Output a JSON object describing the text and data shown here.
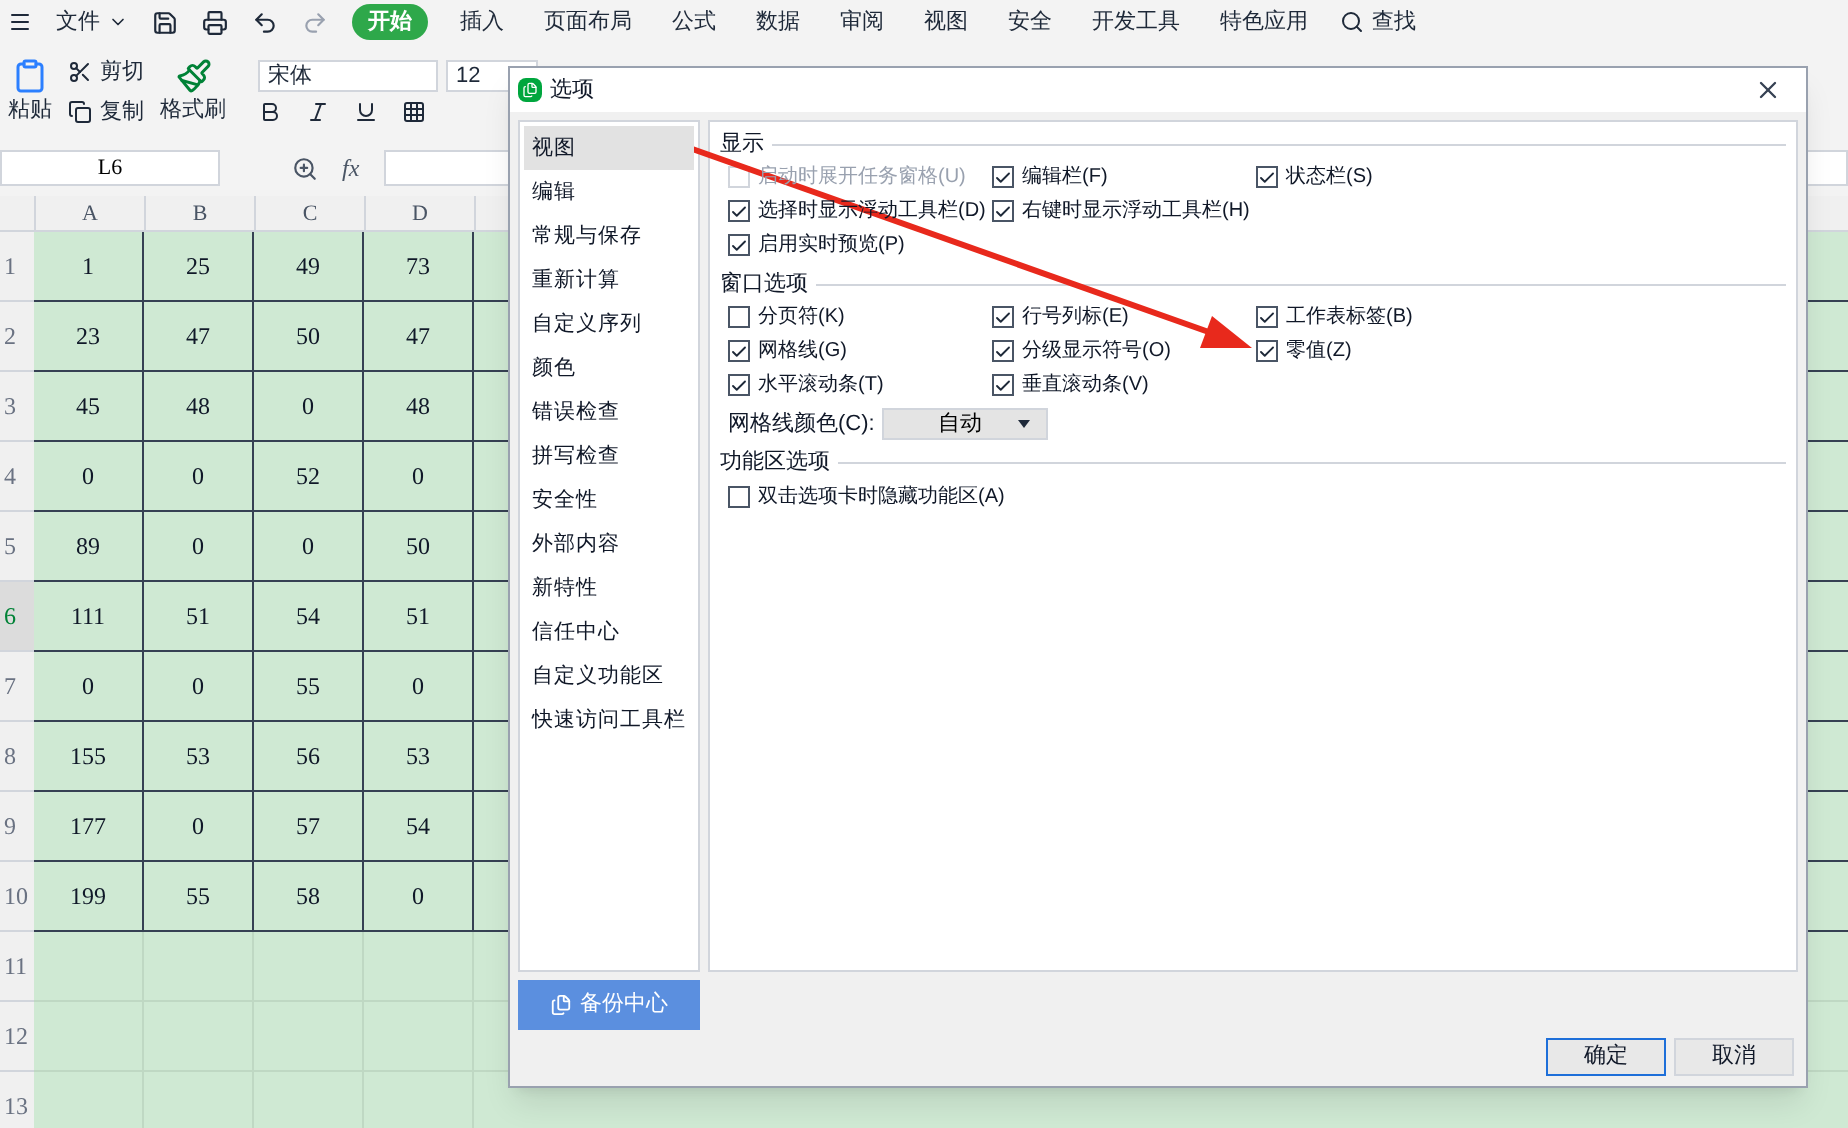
{
  "menu_bar": {
    "file": "文件",
    "tabs": [
      {
        "label": "开始",
        "selected": true
      },
      {
        "label": "插入",
        "selected": false
      },
      {
        "label": "页面布局",
        "selected": false
      },
      {
        "label": "公式",
        "selected": false
      },
      {
        "label": "数据",
        "selected": false
      },
      {
        "label": "审阅",
        "selected": false
      },
      {
        "label": "视图",
        "selected": false
      },
      {
        "label": "安全",
        "selected": false
      },
      {
        "label": "开发工具",
        "selected": false
      },
      {
        "label": "特色应用",
        "selected": false
      }
    ],
    "search": "查找"
  },
  "toolbar": {
    "paste": "粘贴",
    "cut": "剪切",
    "copy": "复制",
    "format_painter": "格式刷",
    "font": "宋体",
    "font_size": "12"
  },
  "formula_bar": {
    "cell": "L6",
    "fx": "fx"
  },
  "sheet": {
    "columns": [
      "A",
      "B",
      "C",
      "D"
    ],
    "rows": [
      {
        "header": "1",
        "selected": false,
        "cells": [
          "1",
          "25",
          "49",
          "73"
        ]
      },
      {
        "header": "2",
        "selected": false,
        "cells": [
          "23",
          "47",
          "50",
          "47"
        ]
      },
      {
        "header": "3",
        "selected": false,
        "cells": [
          "45",
          "48",
          "0",
          "48"
        ]
      },
      {
        "header": "4",
        "selected": false,
        "cells": [
          "0",
          "0",
          "52",
          "0"
        ]
      },
      {
        "header": "5",
        "selected": false,
        "cells": [
          "89",
          "0",
          "0",
          "50"
        ]
      },
      {
        "header": "6",
        "selected": true,
        "cells": [
          "111",
          "51",
          "54",
          "51"
        ]
      },
      {
        "header": "7",
        "selected": false,
        "cells": [
          "0",
          "0",
          "55",
          "0"
        ]
      },
      {
        "header": "8",
        "selected": false,
        "cells": [
          "155",
          "53",
          "56",
          "53"
        ]
      },
      {
        "header": "9",
        "selected": false,
        "cells": [
          "177",
          "0",
          "57",
          "54"
        ]
      },
      {
        "header": "10",
        "selected": false,
        "cells": [
          "199",
          "55",
          "58",
          "0"
        ]
      },
      {
        "header": "11",
        "selected": false
      },
      {
        "header": "12",
        "selected": false
      },
      {
        "header": "13",
        "selected": false
      }
    ]
  },
  "dialog": {
    "title": "选项",
    "sidebar": [
      {
        "label": "视图",
        "selected": true
      },
      {
        "label": "编辑",
        "selected": false
      },
      {
        "label": "常规与保存",
        "selected": false
      },
      {
        "label": "重新计算",
        "selected": false
      },
      {
        "label": "自定义序列",
        "selected": false
      },
      {
        "label": "颜色",
        "selected": false
      },
      {
        "label": "错误检查",
        "selected": false
      },
      {
        "label": "拼写检查",
        "selected": false
      },
      {
        "label": "安全性",
        "selected": false
      },
      {
        "label": "外部内容",
        "selected": false
      },
      {
        "label": "新特性",
        "selected": false
      },
      {
        "label": "信任中心",
        "selected": false
      },
      {
        "label": "自定义功能区",
        "selected": false
      },
      {
        "label": "快速访问工具栏",
        "selected": false
      }
    ],
    "backup_button": "备份中心",
    "sections": [
      {
        "title": "显示",
        "rows": [
          [
            {
              "label": "启动时展开任务窗格(U)",
              "checked": false,
              "disabled": true
            },
            {
              "label": "编辑栏(F)",
              "checked": true,
              "disabled": false
            },
            {
              "label": "状态栏(S)",
              "checked": true,
              "disabled": false
            }
          ],
          [
            {
              "label": "选择时显示浮动工具栏(D)",
              "checked": true,
              "disabled": false
            },
            {
              "label": "右键时显示浮动工具栏(H)",
              "checked": true,
              "disabled": false
            }
          ],
          [
            {
              "label": "启用实时预览(P)",
              "checked": true,
              "disabled": false
            }
          ]
        ]
      },
      {
        "title": "窗口选项",
        "rows": [
          [
            {
              "label": "分页符(K)",
              "checked": false,
              "disabled": false
            },
            {
              "label": "行号列标(E)",
              "checked": true,
              "disabled": false
            },
            {
              "label": "工作表标签(B)",
              "checked": true,
              "disabled": false
            }
          ],
          [
            {
              "label": "网格线(G)",
              "checked": true,
              "disabled": false
            },
            {
              "label": "分级显示符号(O)",
              "checked": true,
              "disabled": false
            },
            {
              "label": "零值(Z)",
              "checked": true,
              "disabled": false
            }
          ],
          [
            {
              "label": "水平滚动条(T)",
              "checked": true,
              "disabled": false
            },
            {
              "label": "垂直滚动条(V)",
              "checked": true,
              "disabled": false
            }
          ]
        ],
        "dropdown": {
          "label": "网格线颜色(C):",
          "value": "自动"
        }
      },
      {
        "title": "功能区选项",
        "rows": [
          [
            {
              "label": "双击选项卡时隐藏功能区(A)",
              "checked": false,
              "disabled": false
            }
          ]
        ]
      }
    ],
    "buttons": [
      {
        "label": "确定",
        "kind": "primary"
      },
      {
        "label": "取消",
        "kind": "secondary"
      }
    ]
  }
}
